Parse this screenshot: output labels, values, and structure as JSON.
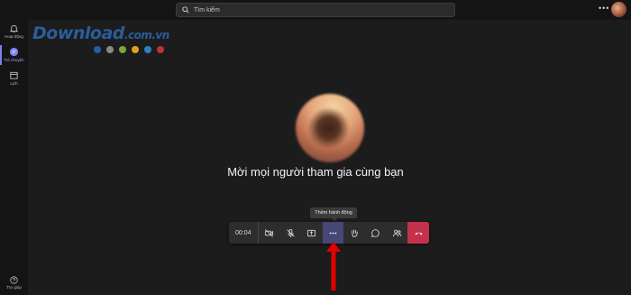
{
  "topbar": {
    "search_placeholder": "Tìm kiếm",
    "more_label": "•••"
  },
  "rail": {
    "items": [
      {
        "label": "Hoạt động",
        "icon": "bell-icon"
      },
      {
        "label": "Trò chuyện",
        "icon": "chat-icon",
        "active": true
      },
      {
        "label": "Lịch",
        "icon": "calendar-icon"
      }
    ],
    "help_label": "Trợ giúp"
  },
  "watermark": {
    "brand": "Download",
    "domain": ".com.vn",
    "dot_colors": [
      "#1f5fa8",
      "#8a8a8a",
      "#7aa83a",
      "#e0a020",
      "#2f7fc0",
      "#c0303a"
    ]
  },
  "call": {
    "invite_text": "Mời mọi người tham gia cùng bạn",
    "timer": "00:04",
    "tooltip": "Thêm hành động",
    "more_label": "•••",
    "accent": "#464775",
    "hangup_color": "#c4314b",
    "arrow_color": "#e00000"
  }
}
